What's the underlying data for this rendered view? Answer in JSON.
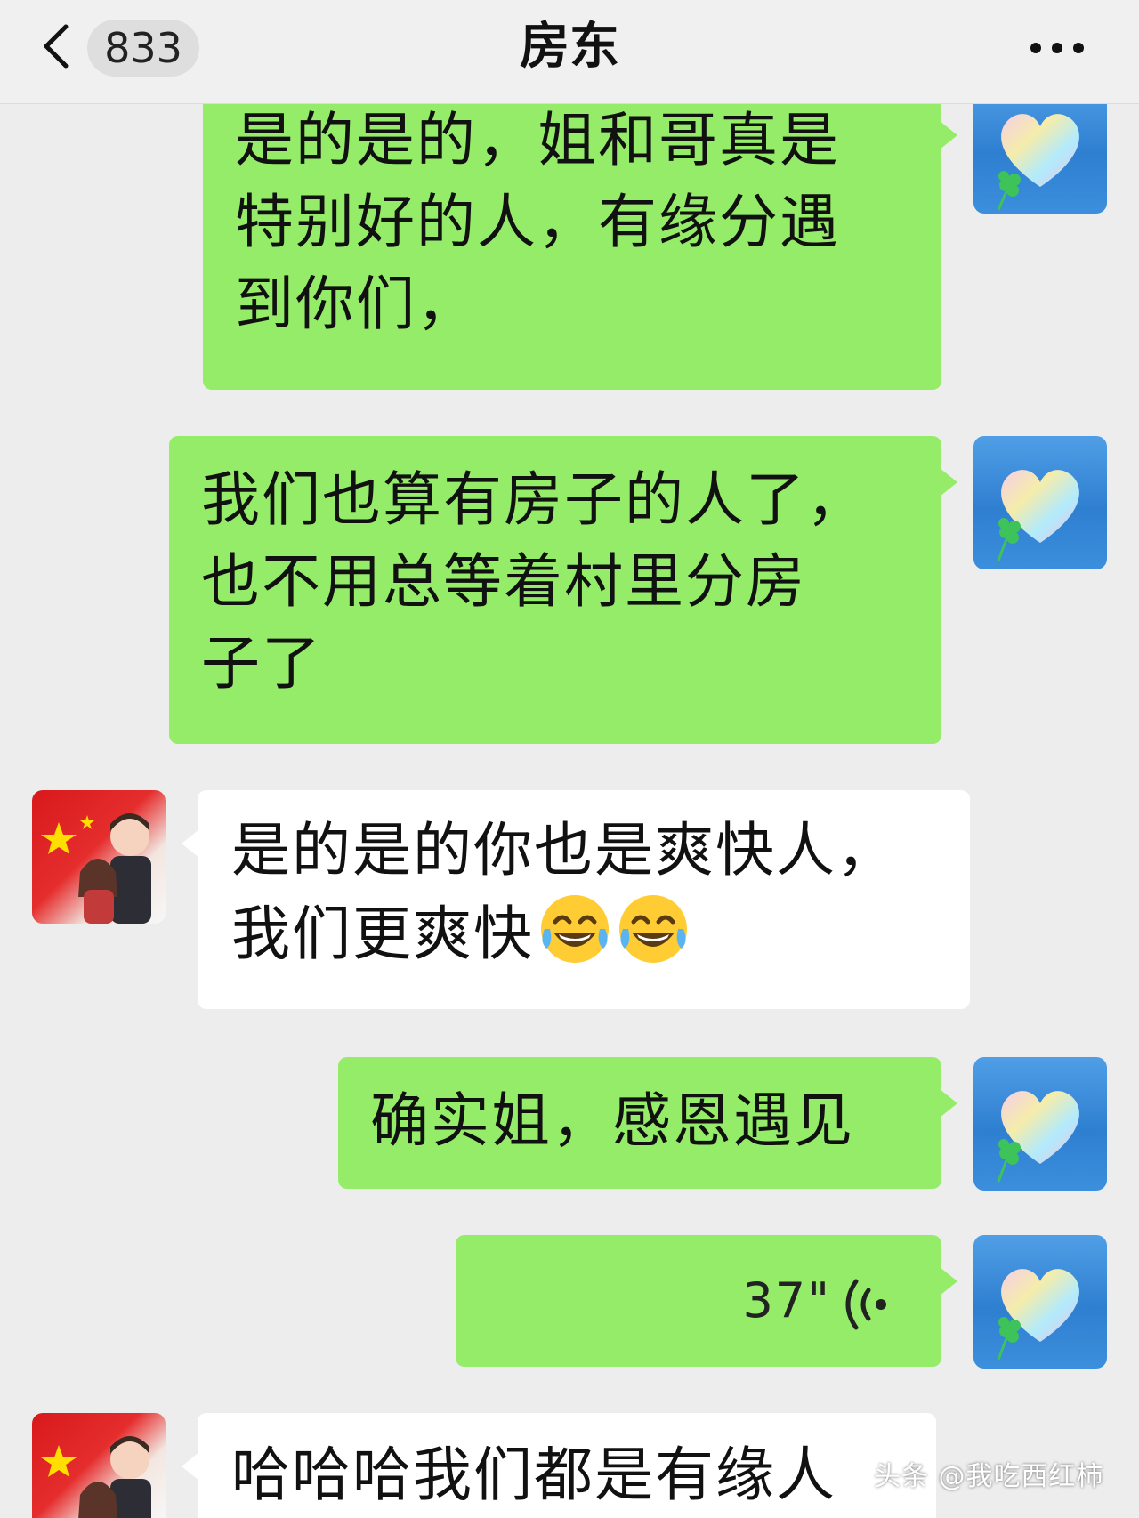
{
  "header": {
    "unread_count": "833",
    "title": "房东"
  },
  "messages": [
    {
      "side": "out",
      "text": "是的是的，姐和哥真是\n特别好的人，有缘分遇\n到你们，"
    },
    {
      "side": "out",
      "text": "我们也算有房子的人了，\n也不用总等着村里分房\n子了"
    },
    {
      "side": "in",
      "text_line1": "是的是的你也是爽快人，",
      "text_line2": "我们更爽快",
      "emoji": "tears-of-joy-emoji"
    },
    {
      "side": "out",
      "text": "确实姐，感恩遇见"
    },
    {
      "side": "out",
      "type": "voice",
      "duration": "37\""
    },
    {
      "side": "in",
      "text": "哈哈哈我们都是有缘人"
    }
  ],
  "watermark": "头条 @我吃西红柿",
  "colors": {
    "outgoing_bubble": "#95ec69",
    "incoming_bubble": "#ffffff",
    "background": "#ededed",
    "header": "#f0f0f0"
  }
}
